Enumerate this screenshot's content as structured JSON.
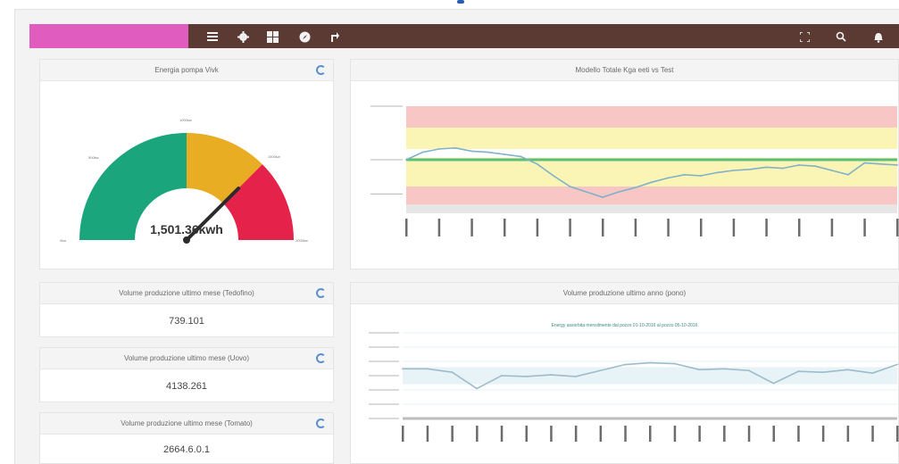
{
  "topbar": {
    "brand_color": "#e05cbf",
    "bar_color": "#5b3a33",
    "left_icons": [
      "menu-icon",
      "gear-icon",
      "dashboard-icon",
      "compass-icon",
      "share-icon"
    ],
    "right_icons": [
      "fullscreen-icon",
      "search-icon",
      "bell-icon"
    ]
  },
  "gauge_panel": {
    "title": "Energia pompa Vivk",
    "value_label": "1,501.36kwh",
    "value": 1501.36,
    "min": 0,
    "max": 2000,
    "zones": [
      {
        "from": 0,
        "to": 1000,
        "color": "#1aa57d"
      },
      {
        "from": 1000,
        "to": 1500,
        "color": "#e8ad22"
      },
      {
        "from": 1500,
        "to": 2000,
        "color": "#e5234a"
      }
    ]
  },
  "stat_panels": [
    {
      "title": "Volume produzione ultimo mese (Tedofino)",
      "value": "739.101"
    },
    {
      "title": "Volume produzione ultimo mese (Uovo)",
      "value": "4138.261"
    },
    {
      "title": "Volume produzione ultimo mese (Tomato)",
      "value": "2664.6.0.1"
    }
  ],
  "chart_top": {
    "panel_title": "Modello Totale Kga eeti vs Test",
    "bands": [
      {
        "name": "upper-red",
        "color": "#f9c6c6"
      },
      {
        "name": "upper-yellow",
        "color": "#fbf5b5"
      },
      {
        "name": "lower-yellow",
        "color": "#fbf5b5"
      },
      {
        "name": "lower-red",
        "color": "#f9c6c6"
      }
    ],
    "chart_data": {
      "type": "line",
      "ylim": [
        0,
        100
      ],
      "reference": 50,
      "series": [
        {
          "values": [
            50,
            57,
            60,
            61,
            58,
            57,
            55,
            53,
            46,
            35,
            25,
            20,
            15,
            20,
            24,
            29,
            33,
            36,
            35,
            38,
            40,
            41,
            43,
            42,
            45,
            44,
            40,
            36,
            47,
            46,
            45
          ]
        }
      ]
    }
  },
  "chart_bottom": {
    "panel_title": "Volume produzione ultimo anno (pono)",
    "inner_title": "Energy assorbita mensilmente dal pozzo 01-10-2016 al pozzo 05-10-2016",
    "chart_data": {
      "type": "line",
      "ylim": [
        0,
        100
      ],
      "series": [
        {
          "values": [
            58,
            58,
            54,
            35,
            50,
            49,
            51,
            49,
            56,
            63,
            65,
            64,
            57,
            58,
            56,
            41,
            55,
            54,
            57,
            53,
            63
          ]
        }
      ]
    }
  }
}
